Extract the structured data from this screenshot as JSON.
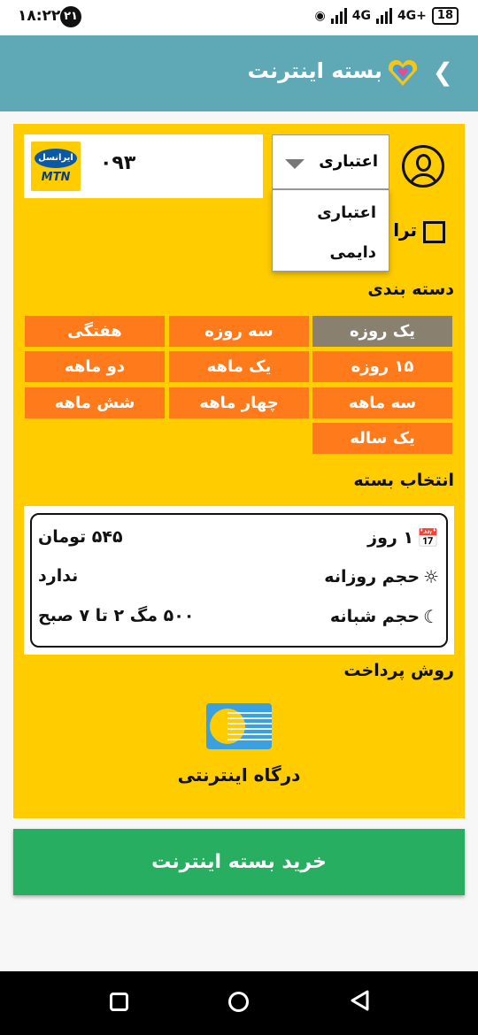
{
  "status_bar": {
    "time": "۱۸:۲۲",
    "notification_count": "۲۱",
    "net1": "4G",
    "net2": "4G+",
    "battery": "18"
  },
  "header": {
    "title": "بسته اینترنت",
    "back_icon": "chevron-left-icon",
    "logo_icon": "app-logo-icon"
  },
  "account": {
    "phone_number": "۰۹۳",
    "operator_name": "ایرانسل",
    "operator_brand": "MTN",
    "avatar_icon": "user-avatar-icon"
  },
  "sim_type": {
    "selected": "اعتباری",
    "options": [
      "اعتباری",
      "دایمی"
    ]
  },
  "checkbox_label": "ترا",
  "categories": {
    "title": "دسته بندی",
    "items": [
      "یک روزه",
      "سه روزه",
      "هفتگی",
      "۱۵ روزه",
      "یک ماهه",
      "دو ماهه",
      "سه ماهه",
      "چهار ماهه",
      "شش ماهه",
      "یک ساله"
    ],
    "selected": "یک روزه"
  },
  "package": {
    "title": "انتخاب بسته",
    "duration": "۱ روز",
    "price": "۵۴۵ تومان",
    "daily_label": "حجم روزانه",
    "daily_value": "ندارد",
    "night_label": "حجم شبانه",
    "night_value": "۵۰۰ مگ ۲ تا ۷ صبح"
  },
  "payment": {
    "title": "روش پرداخت",
    "gateway_label": "درگاه اینترنتی"
  },
  "buy_button": "خرید بسته اینترنت",
  "colors": {
    "appbar": "#5fa8b6",
    "panel": "#ffcc00",
    "category": "#ff7a1a",
    "category_selected": "#8a8070",
    "buy": "#27ae60"
  }
}
